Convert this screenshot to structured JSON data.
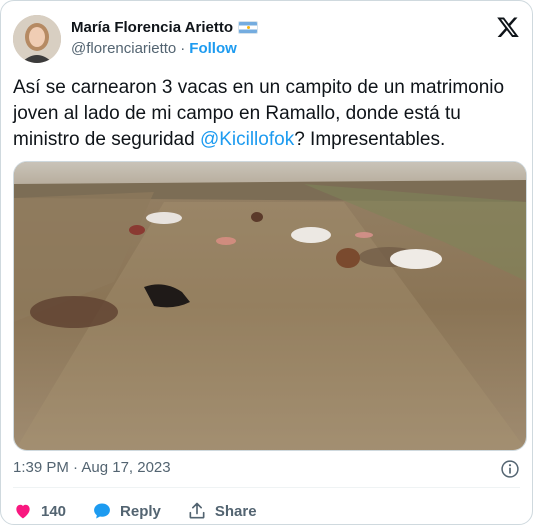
{
  "author": {
    "name": "María Florencia Arietto",
    "handle": "@florenciarietto",
    "separator": "·",
    "follow_label": "Follow"
  },
  "tweet": {
    "text_before": "Así se carnearon 3 vacas en un campito de un matrimonio joven al lado de mi campo en Ramallo, donde está tu ministro de seguridad ",
    "mention": "@Kicillofok",
    "text_after": "? Impresentables."
  },
  "meta": {
    "timestamp": "1:39 PM · Aug 17, 2023"
  },
  "actions": {
    "like_count": "140",
    "reply_label": "Reply",
    "share_label": "Share"
  },
  "colors": {
    "accent": "#1d9bf0",
    "like": "#f91880",
    "text_secondary": "#536471"
  },
  "icons": [
    "argentina-flag-icon",
    "x-logo-icon",
    "info-icon",
    "heart-icon",
    "reply-bubble-icon",
    "share-icon"
  ]
}
